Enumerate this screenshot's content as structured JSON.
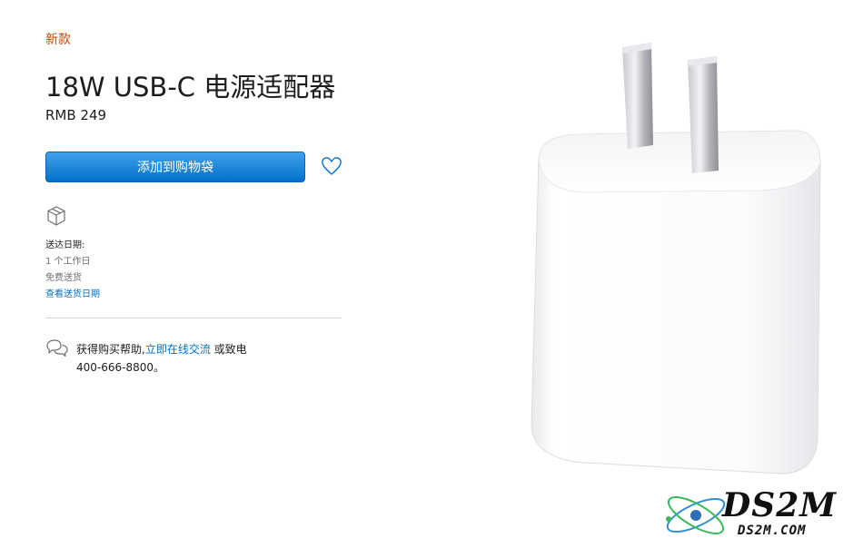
{
  "product": {
    "badge": "新款",
    "title": "18W USB-C 电源适配器",
    "price": "RMB 249",
    "add_to_bag_label": "添加到购物袋",
    "image_name": "usb-c-power-adapter"
  },
  "delivery": {
    "heading": "送达日期:",
    "time": "1 个工作日",
    "shipping": "免费送货",
    "check_link": "查看送货日期"
  },
  "help": {
    "prefix": "获得购买帮助,",
    "chat_link": "立即在线交流",
    "suffix": " 或致电",
    "phone": "400-666-8800。"
  },
  "watermark": {
    "brand": "DS2M",
    "domain": "DS2M.COM"
  },
  "colors": {
    "accent": "#0070c9",
    "badge": "#bf4800",
    "divider": "#d2d2d7"
  }
}
